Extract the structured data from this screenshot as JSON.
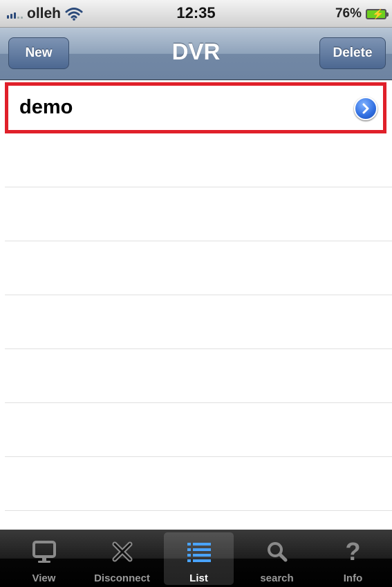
{
  "status_bar": {
    "carrier": "olleh",
    "time": "12:35",
    "battery": "76%"
  },
  "nav": {
    "title": "DVR",
    "left_button": "New",
    "right_button": "Delete"
  },
  "list": {
    "items": [
      {
        "label": "demo",
        "selected": true
      }
    ]
  },
  "tabbar": {
    "tabs": [
      {
        "label": "View",
        "icon": "monitor-icon"
      },
      {
        "label": "Disconnect",
        "icon": "disconnect-x-icon"
      },
      {
        "label": "List",
        "icon": "list-icon",
        "active": true
      },
      {
        "label": "search",
        "icon": "search-icon"
      },
      {
        "label": "Info",
        "icon": "question-icon"
      }
    ]
  },
  "colors": {
    "selection_border": "#e0202a",
    "navbar": "#7288a5",
    "active_tab_icon": "#4aa3ff"
  }
}
